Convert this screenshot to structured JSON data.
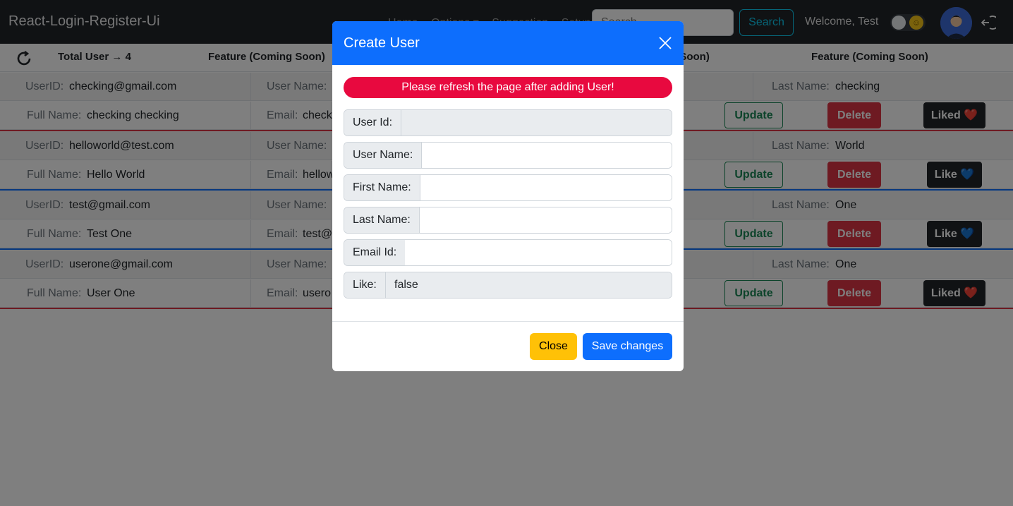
{
  "navbar": {
    "brand": "React-Login-Register-Ui",
    "links": [
      "Home",
      "Options ▾",
      "Suggestion",
      "Setup"
    ],
    "search_placeholder": "Search",
    "search_button": "Search",
    "welcome": "Welcome, Test",
    "theme_icon": "sun-icon",
    "avatar_icon": "avatar-icon",
    "logout_icon": "logout-icon"
  },
  "subbar": {
    "refresh_icon": "refresh-icon",
    "total_users": "Total User → 4",
    "feature_1": "Feature (Coming Soon)",
    "feature_2": "Feature (Coming Soon)",
    "feature_3": "Feature (Coming Soon)"
  },
  "labels": {
    "user_id": "UserID:",
    "user_name": "User Name:",
    "last_name": "Last Name:",
    "full_name": "Full Name:",
    "email": "Email:",
    "update": "Update",
    "delete": "Delete"
  },
  "users": [
    {
      "user_id": "checking@gmail.com",
      "user_name": "",
      "last_name": "checking",
      "full_name": "checking checking",
      "email": "check",
      "like_label": "Liked ❤️",
      "liked": true,
      "divider_color": "#dc3545"
    },
    {
      "user_id": "helloworld@test.com",
      "user_name": "",
      "last_name": "World",
      "full_name": "Hello World",
      "email": "hellow",
      "like_label": "Like 💙",
      "liked": false,
      "divider_color": "#0d6efd"
    },
    {
      "user_id": "test@gmail.com",
      "user_name": "",
      "last_name": "One",
      "full_name": "Test One",
      "email": "test@",
      "like_label": "Like 💙",
      "liked": false,
      "divider_color": "#0d6efd"
    },
    {
      "user_id": "userone@gmail.com",
      "user_name": "",
      "last_name": "One",
      "full_name": "User One",
      "email": "usero",
      "like_label": "Liked ❤️",
      "liked": true,
      "divider_color": "#dc3545"
    }
  ],
  "modal": {
    "title": "Create User",
    "close_icon": "close-icon",
    "alert": "Please refresh the page after adding User!",
    "fields": [
      {
        "label": "User Id:",
        "value": "",
        "readonly": true
      },
      {
        "label": "User Name:",
        "value": "",
        "readonly": false
      },
      {
        "label": "First Name:",
        "value": "",
        "readonly": false
      },
      {
        "label": "Last Name:",
        "value": "",
        "readonly": false
      },
      {
        "label": "Email Id:",
        "value": "",
        "readonly": false
      },
      {
        "label": "Like:",
        "value": "false",
        "readonly": true
      }
    ],
    "close_button": "Close",
    "save_button": "Save changes"
  },
  "colors": {
    "navbar_bg": "#212529",
    "primary": "#0d6efd",
    "alert_bg": "#e8093f",
    "warning": "#ffc107",
    "success": "#198754",
    "danger": "#dc3545"
  }
}
